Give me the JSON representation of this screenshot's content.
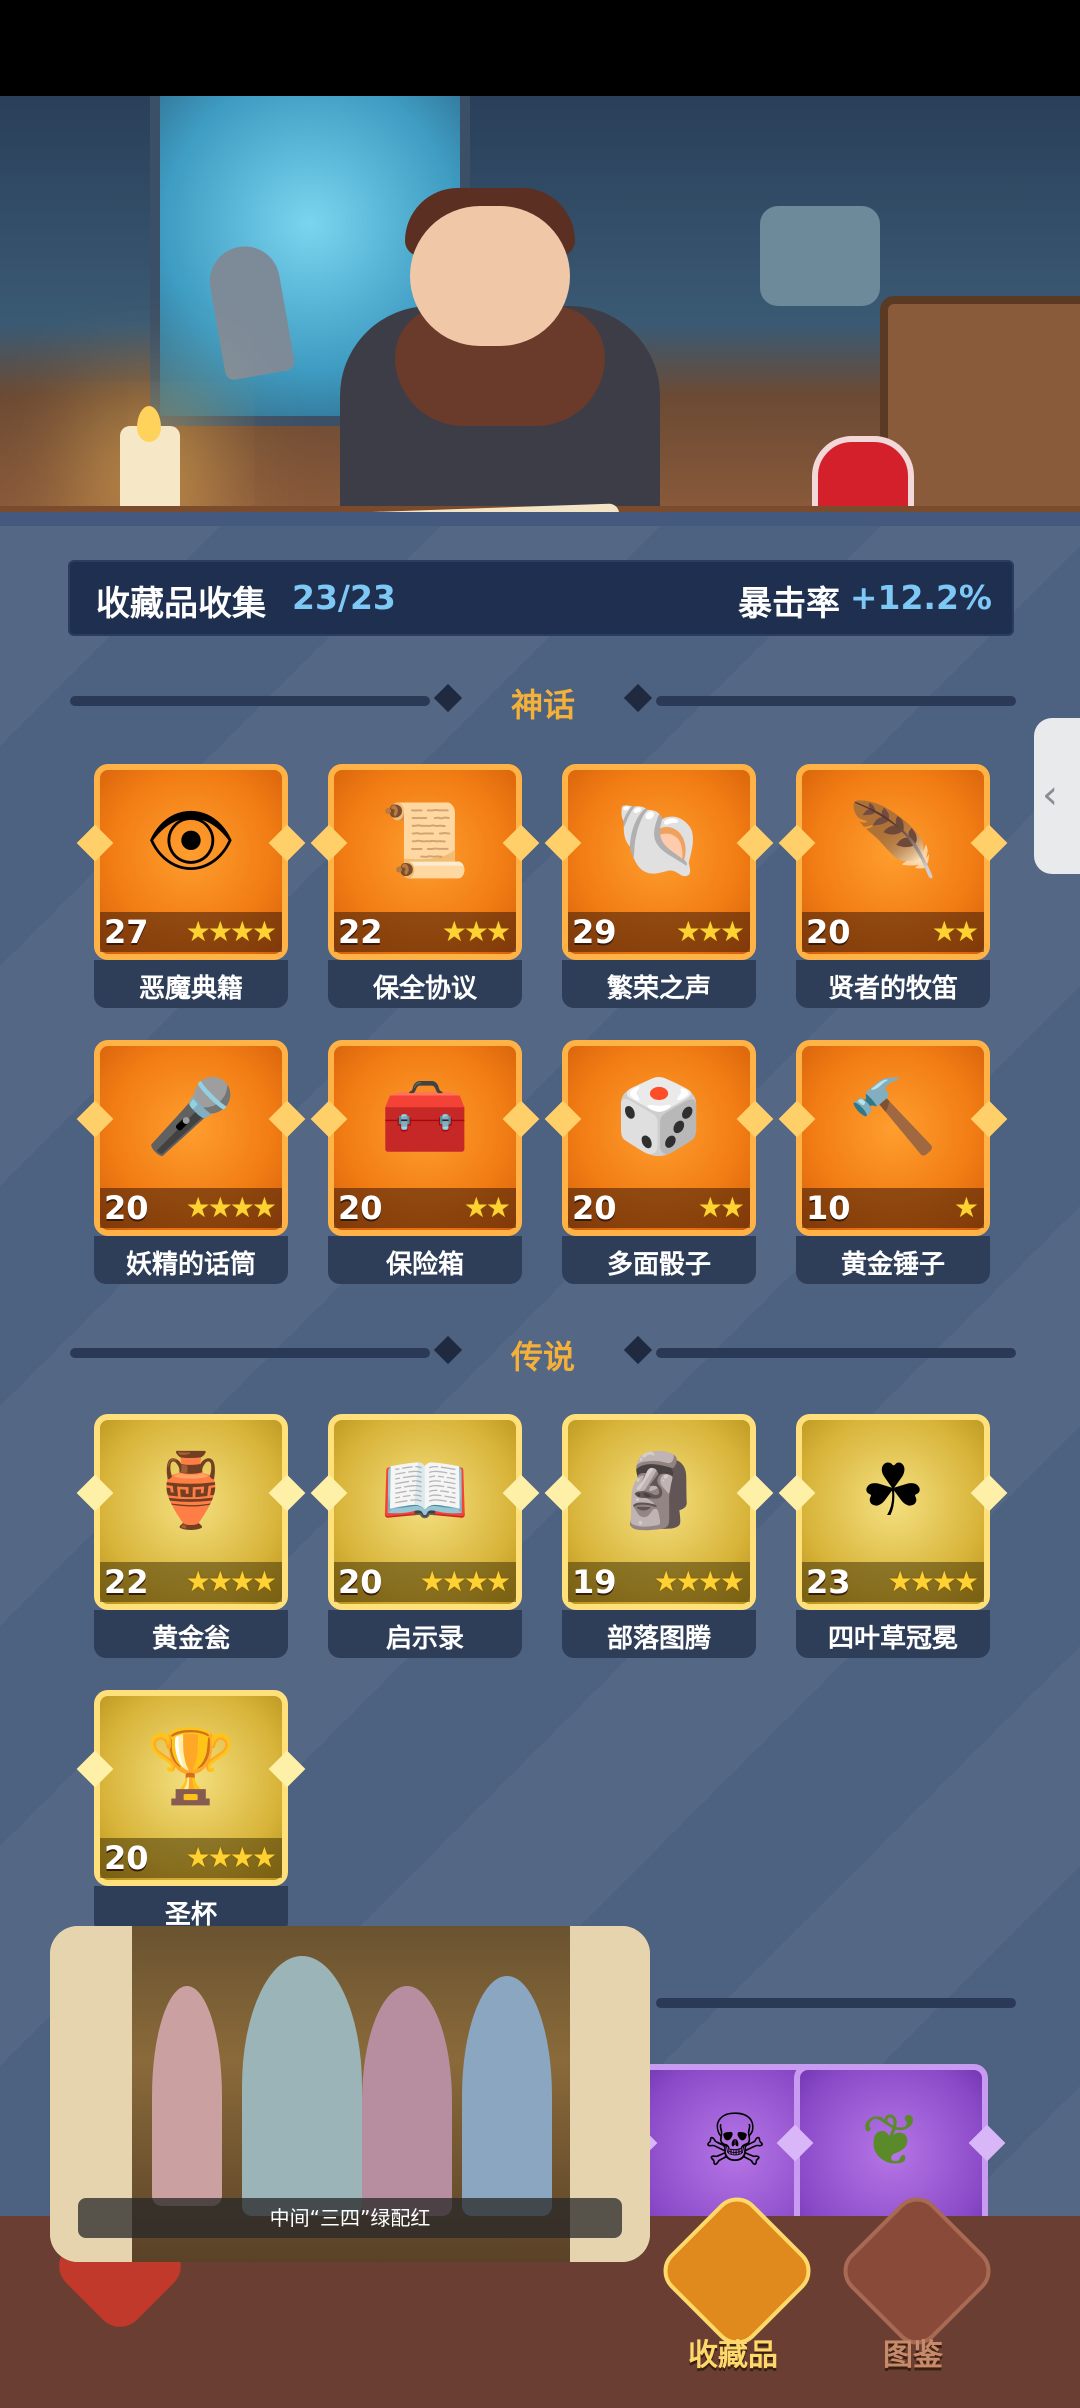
{
  "collection": {
    "label": "收藏品收集",
    "count": "23/23",
    "crit_label": "暴击率",
    "crit_value": "+12.2%"
  },
  "sections": {
    "myth": "神话",
    "legend": "传说"
  },
  "myth_items": [
    {
      "name": "恶魔典籍",
      "level": "27",
      "stars": "★★★★",
      "icon": "demon-book-icon"
    },
    {
      "name": "保全协议",
      "level": "22",
      "stars": "★★★",
      "icon": "contract-scroll-icon"
    },
    {
      "name": "繁荣之声",
      "level": "29",
      "stars": "★★★",
      "icon": "conch-horn-icon"
    },
    {
      "name": "贤者的牧笛",
      "level": "20",
      "stars": "★★",
      "icon": "sage-flute-icon"
    },
    {
      "name": "妖精的话筒",
      "level": "20",
      "stars": "★★★★",
      "icon": "fairy-microphone-icon"
    },
    {
      "name": "保险箱",
      "level": "20",
      "stars": "★★",
      "icon": "treasure-chest-icon"
    },
    {
      "name": "多面骰子",
      "level": "20",
      "stars": "★★",
      "icon": "d20-dice-icon"
    },
    {
      "name": "黄金锤子",
      "level": "10",
      "stars": "★",
      "icon": "golden-hammer-icon"
    }
  ],
  "legend_items": [
    {
      "name": "黄金瓮",
      "level": "22",
      "stars": "★★★★",
      "icon": "golden-urn-icon"
    },
    {
      "name": "启示录",
      "level": "20",
      "stars": "★★★★",
      "icon": "open-book-icon"
    },
    {
      "name": "部落图腾",
      "level": "19",
      "stars": "★★★★",
      "icon": "tribal-totem-icon"
    },
    {
      "name": "四叶草冠冕",
      "level": "23",
      "stars": "★★★★",
      "icon": "clover-crown-icon"
    },
    {
      "name": "圣杯",
      "level": "20",
      "stars": "★★★★",
      "icon": "holy-grail-icon"
    }
  ],
  "video": {
    "caption": "中间“三四”绿配红"
  },
  "nav": {
    "collection_label": "收藏品",
    "guide_label": "图鉴"
  },
  "colors": {
    "background": "#4d6180",
    "stat_bar": "#1f2f4f",
    "accent_blue": "#7ec8f5",
    "section_title": "#f4b13a",
    "myth_orange": "#f17c14",
    "legend_gold": "#d8b43a",
    "epic_purple": "#8a4ac8",
    "nav_bg": "#6b3e33"
  }
}
